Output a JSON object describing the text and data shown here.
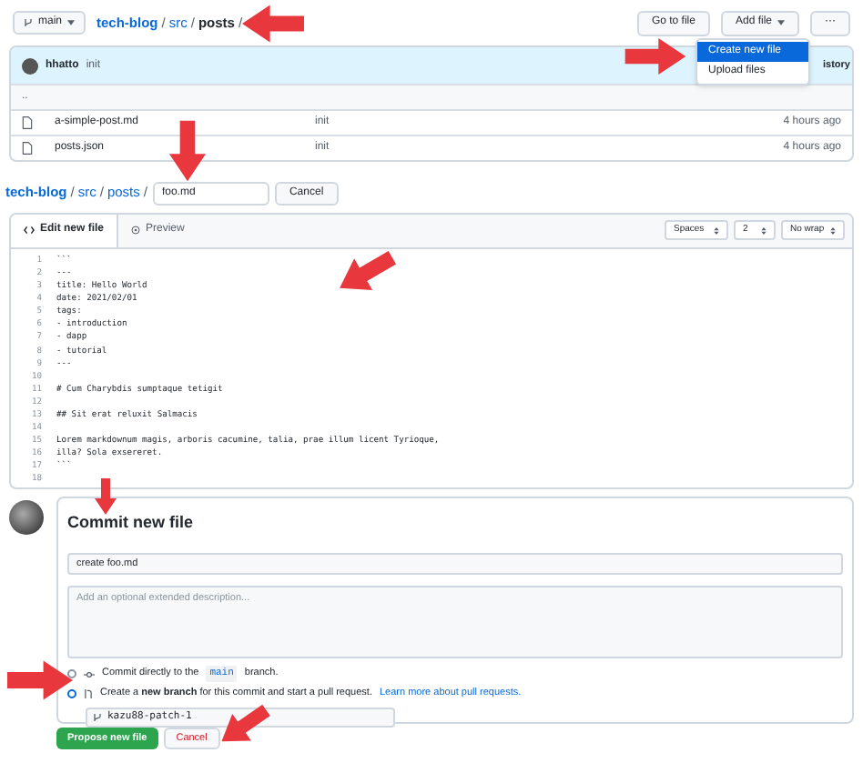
{
  "top_bar": {
    "branch": "main",
    "breadcrumb": [
      {
        "label": "tech-blog",
        "kind": "repo",
        "separator": "/"
      },
      {
        "label": "src",
        "kind": "dir",
        "separator": "/"
      },
      {
        "label": "posts",
        "kind": "current",
        "separator": "/"
      }
    ],
    "buttons": [
      {
        "label": "Go to file",
        "kind": "plain"
      },
      {
        "label": "Add file",
        "kind": "menu"
      },
      {
        "label": "···",
        "kind": "more"
      }
    ]
  },
  "add_file_menu": {
    "items": [
      {
        "label": "Create new file",
        "selected": true
      },
      {
        "label": "Upload files",
        "selected": false
      }
    ]
  },
  "file_list": {
    "commit": {
      "author": "hhatto",
      "message": "init",
      "history": "istory"
    },
    "rows": [
      {
        "name": "..",
        "kind": "parent"
      },
      {
        "name": "a-simple-post.md",
        "kind": "file",
        "message": "init",
        "time": "4 hours ago"
      },
      {
        "name": "posts.json",
        "kind": "file",
        "message": "init",
        "time": "4 hours ago"
      }
    ]
  },
  "path_row": {
    "breadcrumb": [
      {
        "label": "tech-blog",
        "kind": "repo",
        "separator": "/"
      },
      {
        "label": "src",
        "kind": "dir",
        "separator": "/"
      },
      {
        "label": "posts",
        "kind": "dir",
        "separator": "/"
      }
    ],
    "filename": "foo.md",
    "cancel": "Cancel"
  },
  "editor": {
    "tabs": [
      {
        "label": "Edit new file",
        "selected": true
      },
      {
        "label": "Preview",
        "selected": false
      }
    ],
    "selects": [
      "Spaces",
      "2",
      "No wrap"
    ],
    "lines": [
      {
        "number": "1",
        "text": "```"
      },
      {
        "number": "2",
        "text": "---"
      },
      {
        "number": "3",
        "text": "title: Hello World"
      },
      {
        "number": "4",
        "text": "date: 2021/02/01"
      },
      {
        "number": "5",
        "text": "tags:"
      },
      {
        "number": "6",
        "text": "- introduction"
      },
      {
        "number": "7",
        "text": "- dapp"
      },
      {
        "number": "8",
        "text": "- tutorial"
      },
      {
        "number": "9",
        "text": "---"
      },
      {
        "number": "10"
      },
      {
        "number": "11",
        "text": "# Cum Charybdis sumptaque tetigit"
      },
      {
        "number": "12"
      },
      {
        "number": "13",
        "text": "## Sit erat reluxit Salmacis"
      },
      {
        "number": "14"
      },
      {
        "number": "15",
        "text": "Lorem markdownum magis, arboris cacumine, talia, prae illum licent Tyrioque,"
      },
      {
        "number": "16",
        "text": "illa? Sola exsereret."
      },
      {
        "number": "17",
        "text": "```"
      },
      {
        "number": "18"
      }
    ]
  },
  "commit_form": {
    "title": "Commit new file",
    "summary": "create foo.md",
    "description_placeholder": "Add an optional extended description...",
    "options": [
      {
        "kind": "direct",
        "selected": false,
        "text": "Commit directly to the",
        "code": "main",
        "after": "branch."
      },
      {
        "kind": "branch",
        "selected": true,
        "text": "Create a **new branch** for this commit and start a pull request.",
        "link": "Learn more about pull requests."
      }
    ],
    "branch_name": "kazu88-patch-1",
    "submit": "Propose new file",
    "cancel": "Cancel"
  }
}
